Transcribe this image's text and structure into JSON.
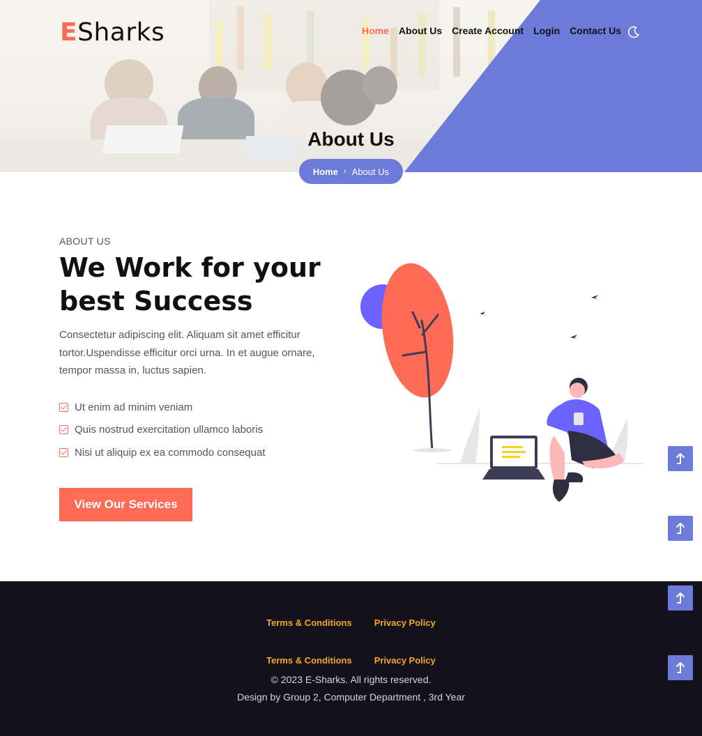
{
  "brand": {
    "letter": "E",
    "rest": "Sharks"
  },
  "nav": [
    {
      "label": "Home",
      "active": true
    },
    {
      "label": "About Us"
    },
    {
      "label": "Create Account"
    },
    {
      "label": "Login"
    },
    {
      "label": "Contact Us"
    }
  ],
  "theme_toggle_icon": "moon-icon",
  "hero": {
    "title": "About Us",
    "breadcrumb": {
      "home": "Home",
      "separator": "›",
      "current": "About Us"
    }
  },
  "about": {
    "subtitle": "ABOUT US",
    "headline_bold": "We Work",
    "headline_rest": " for your best Success",
    "paragraph": "Consectetur adipiscing elit. Aliquam sit amet efficitur tortor.Uspendisse efficitur orci urna. In et augue ornare, tempor massa in, luctus sapien.",
    "checklist": [
      "Ut enim ad minim veniam",
      "Quis nostrud exercitation ullamco laboris",
      "Nisi ut aliquip ex ea commodo consequat"
    ],
    "button": "View Our Services"
  },
  "scroll_top_icon": "arrow-up-icon",
  "footer": {
    "links_1": [
      "Terms & Conditions",
      "Privacy Policy"
    ],
    "links_2": [
      "Terms & Conditions",
      "Privacy Policy"
    ],
    "copyright": "© 2023 E-Sharks. All rights reserved.",
    "credit": "Design by Group 2, Computer Department , 3rd Year"
  },
  "colors": {
    "accent": "#ff6b57",
    "primary": "#6c7ad9",
    "footer_bg": "#12111c",
    "footer_link": "#f5a623"
  }
}
